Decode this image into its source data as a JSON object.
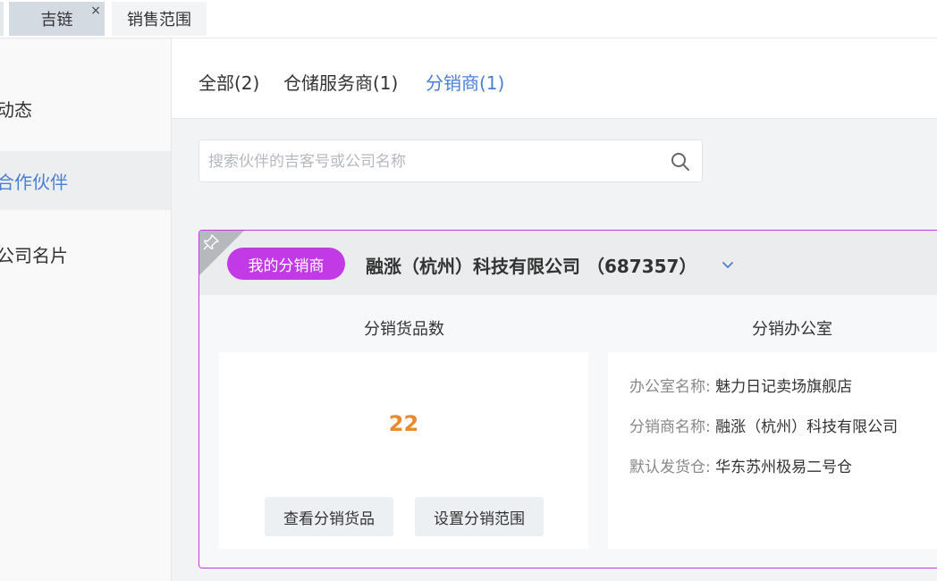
{
  "tabs": [
    {
      "label": "吉链",
      "close": "×"
    },
    {
      "label": "销售范围"
    }
  ],
  "sidebar": {
    "items": [
      {
        "label": "动态"
      },
      {
        "label": "合作伙伴"
      },
      {
        "label": "公司名片"
      }
    ]
  },
  "filters": [
    {
      "label": "全部(2)"
    },
    {
      "label": "仓储服务商(1)"
    },
    {
      "label": "分销商(1)"
    }
  ],
  "search": {
    "placeholder": "搜索伙伴的吉客号或公司名称",
    "value": ""
  },
  "card": {
    "badge": "我的分销商",
    "company": "融涨（杭州）科技有限公司 （687357）",
    "left_title": "分销货品数",
    "count": "22",
    "buttons": {
      "view": "查看分销货品",
      "set": "设置分销范围"
    },
    "right_title": "分销办公室",
    "info": [
      {
        "key": "办公室名称:",
        "value": "魅力日记卖场旗舰店"
      },
      {
        "key": "分销商名称:",
        "value": "融涨（杭州）科技有限公司"
      },
      {
        "key": "默认发货仓:",
        "value": "华东苏州极易二号仓"
      }
    ]
  },
  "colors": {
    "accent": "#4a7fd6",
    "badge": "#c13ae6",
    "count": "#e98a2c"
  }
}
